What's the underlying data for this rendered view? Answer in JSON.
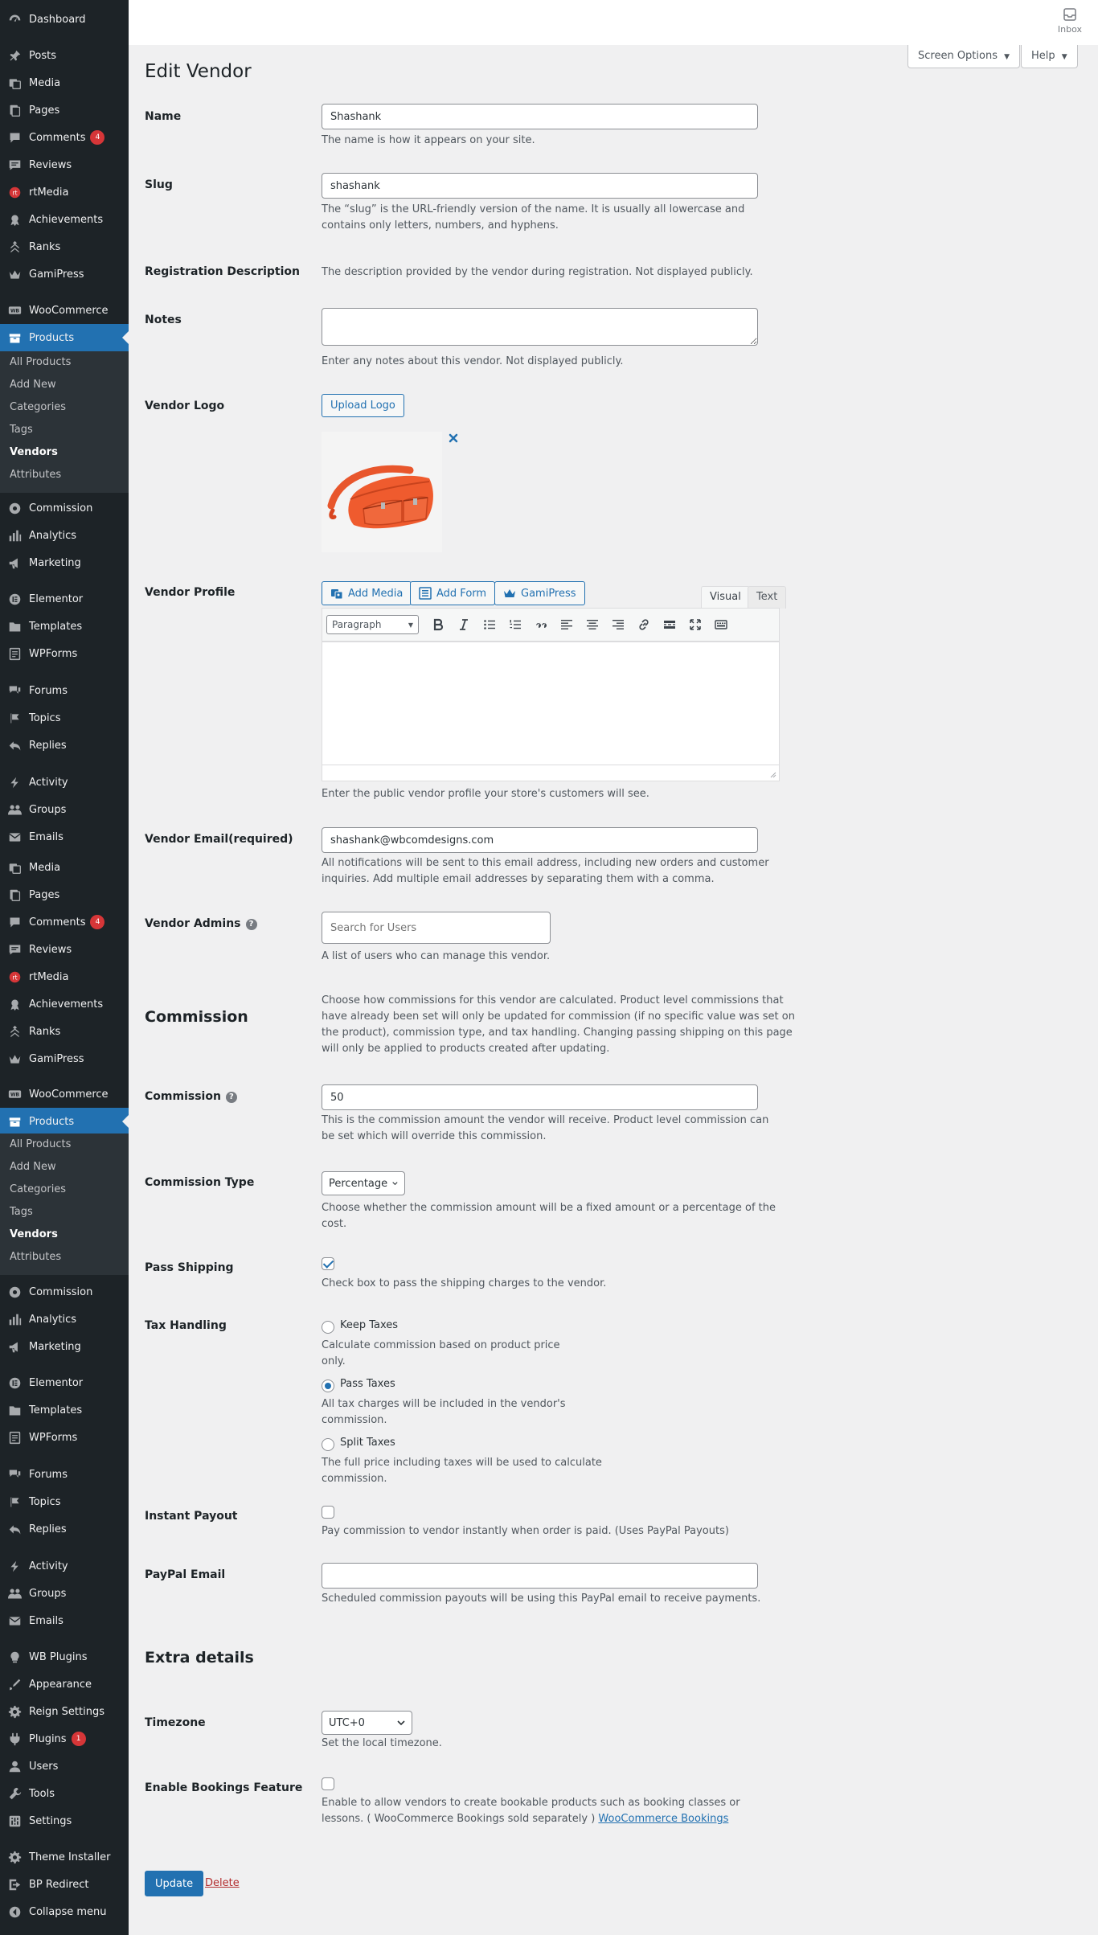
{
  "sidebar": {
    "items": [
      {
        "label": "Dashboard",
        "icon": "dashboard-icon"
      },
      {
        "label": "Posts",
        "icon": "pin-icon"
      },
      {
        "label": "Media",
        "icon": "media-icon"
      },
      {
        "label": "Pages",
        "icon": "pages-icon"
      },
      {
        "label": "Comments",
        "icon": "comments-icon",
        "badge": "4"
      },
      {
        "label": "Reviews",
        "icon": "reviews-icon"
      },
      {
        "label": "rtMedia",
        "icon": "rtmedia-icon"
      },
      {
        "label": "Achievements",
        "icon": "achievements-icon"
      },
      {
        "label": "Ranks",
        "icon": "ranks-icon"
      },
      {
        "label": "GamiPress",
        "icon": "gamipress-icon"
      },
      {
        "label": "WooCommerce",
        "icon": "woocommerce-icon"
      },
      {
        "label": "Products",
        "icon": "products-icon"
      },
      {
        "label": "Commission",
        "icon": "commission-icon"
      },
      {
        "label": "Analytics",
        "icon": "analytics-icon"
      },
      {
        "label": "Marketing",
        "icon": "marketing-icon"
      },
      {
        "label": "Elementor",
        "icon": "elementor-icon"
      },
      {
        "label": "Templates",
        "icon": "templates-icon"
      },
      {
        "label": "WPForms",
        "icon": "wpforms-icon"
      },
      {
        "label": "Forums",
        "icon": "forums-icon"
      },
      {
        "label": "Topics",
        "icon": "topics-icon"
      },
      {
        "label": "Replies",
        "icon": "replies-icon"
      },
      {
        "label": "Activity",
        "icon": "activity-icon"
      },
      {
        "label": "Groups",
        "icon": "groups-icon"
      },
      {
        "label": "Emails",
        "icon": "emails-icon"
      },
      {
        "label": "Media",
        "icon": "media-icon"
      },
      {
        "label": "Pages",
        "icon": "pages-icon"
      },
      {
        "label": "Comments",
        "icon": "comments-icon",
        "badge": "4"
      },
      {
        "label": "Reviews",
        "icon": "reviews-icon"
      },
      {
        "label": "rtMedia",
        "icon": "rtmedia-icon"
      },
      {
        "label": "Achievements",
        "icon": "achievements-icon"
      },
      {
        "label": "Ranks",
        "icon": "ranks-icon"
      },
      {
        "label": "GamiPress",
        "icon": "gamipress-icon"
      },
      {
        "label": "WooCommerce",
        "icon": "woocommerce-icon"
      },
      {
        "label": "Products",
        "icon": "products-icon"
      },
      {
        "label": "Commission",
        "icon": "commission-icon"
      },
      {
        "label": "Analytics",
        "icon": "analytics-icon"
      },
      {
        "label": "Marketing",
        "icon": "marketing-icon"
      },
      {
        "label": "Elementor",
        "icon": "elementor-icon"
      },
      {
        "label": "Templates",
        "icon": "templates-icon"
      },
      {
        "label": "WPForms",
        "icon": "wpforms-icon"
      },
      {
        "label": "Forums",
        "icon": "forums-icon"
      },
      {
        "label": "Topics",
        "icon": "topics-icon"
      },
      {
        "label": "Replies",
        "icon": "replies-icon"
      },
      {
        "label": "Activity",
        "icon": "activity-icon"
      },
      {
        "label": "Groups",
        "icon": "groups-icon"
      },
      {
        "label": "Emails",
        "icon": "emails-icon"
      },
      {
        "label": "WB Plugins",
        "icon": "bulb-icon"
      },
      {
        "label": "Appearance",
        "icon": "appearance-icon"
      },
      {
        "label": "Reign Settings",
        "icon": "gear-icon"
      },
      {
        "label": "Plugins",
        "icon": "plugins-icon",
        "badge": "1"
      },
      {
        "label": "Users",
        "icon": "users-icon"
      },
      {
        "label": "Tools",
        "icon": "tools-icon"
      },
      {
        "label": "Settings",
        "icon": "settings-icon"
      },
      {
        "label": "Theme Installer",
        "icon": "gear-icon"
      },
      {
        "label": "BP Redirect",
        "icon": "redirect-icon"
      },
      {
        "label": "Collapse menu",
        "icon": "collapse-icon"
      }
    ],
    "products_sub": [
      "All Products",
      "Add New",
      "Categories",
      "Tags",
      "Vendors",
      "Attributes"
    ]
  },
  "topbar": {
    "inbox_label": "Inbox",
    "screen_options": "Screen Options",
    "help": "Help"
  },
  "page": {
    "title": "Edit Vendor"
  },
  "form": {
    "name": {
      "label": "Name",
      "value": "Shashank",
      "desc": "The name is how it appears on your site."
    },
    "slug": {
      "label": "Slug",
      "value": "shashank",
      "desc1": "The “slug” is the URL-friendly version of the name. It is usually all lowercase and",
      "desc2": "contains only letters, numbers, and hyphens."
    },
    "registration": {
      "label": "Registration Description",
      "desc": "The description provided by the vendor during registration. Not displayed publicly."
    },
    "notes": {
      "label": "Notes",
      "desc": "Enter any notes about this vendor. Not displayed publicly."
    },
    "logo": {
      "label": "Vendor Logo",
      "button": "Upload Logo"
    },
    "profile": {
      "label": "Vendor Profile",
      "add_media": "Add Media",
      "add_form": "Add Form",
      "gamipress": "GamiPress",
      "tab_visual": "Visual",
      "tab_text": "Text",
      "format": "Paragraph",
      "desc": "Enter the public vendor profile your store's customers will see."
    },
    "email": {
      "label": "Vendor Email(required)",
      "value": "shashank@wbcomdesigns.com",
      "desc1": "All notifications will be sent to this email address, including new orders and customer",
      "desc2": "inquiries. Add multiple email addresses by separating them with a comma."
    },
    "admins": {
      "label": "Vendor Admins",
      "placeholder": "Search for Users",
      "desc": "A list of users who can manage this vendor."
    },
    "commission_section": {
      "heading": "Commission",
      "desc": [
        "Choose how commissions for this vendor are calculated. Product level commissions that",
        "have already been set will only be updated for commission (if no specific value was set on",
        "the product), commission type, and tax handling. Changing passing shipping on this page",
        "will only be applied to products created after updating."
      ]
    },
    "commission": {
      "label": "Commission",
      "value": "50",
      "desc1": "This is the commission amount the vendor will receive. Product level commission can",
      "desc2": "be set which will override this commission."
    },
    "commission_type": {
      "label": "Commission Type",
      "value": "Percentage",
      "desc1": "Choose whether the commission amount will be a fixed amount or a percentage of the",
      "desc2": "cost."
    },
    "pass_shipping": {
      "label": "Pass Shipping",
      "checked": true,
      "desc": "Check box to pass the shipping charges to the vendor."
    },
    "tax": {
      "label": "Tax Handling",
      "options": [
        {
          "label": "Keep Taxes",
          "desc1": "Calculate commission based on product price",
          "desc2": "only.",
          "checked": false
        },
        {
          "label": "Pass Taxes",
          "desc1": "All tax charges will be included in the vendor's",
          "desc2": "commission.",
          "checked": true
        },
        {
          "label": "Split Taxes",
          "desc1": "The full price including taxes will be used to calculate",
          "desc2": "commission.",
          "checked": false
        }
      ]
    },
    "instant_payout": {
      "label": "Instant Payout",
      "checked": false,
      "desc": "Pay commission to vendor instantly when order is paid. (Uses PayPal Payouts)"
    },
    "paypal": {
      "label": "PayPal Email",
      "desc": "Scheduled commission payouts will be using this PayPal email to receive payments."
    },
    "extra": {
      "heading": "Extra details"
    },
    "timezone": {
      "label": "Timezone",
      "value": "UTC+0",
      "desc": "Set the local timezone."
    },
    "bookings": {
      "label": "Enable Bookings Feature",
      "checked": false,
      "desc1": "Enable to allow vendors to create bookable products such as booking classes or",
      "desc2": "lessons. ( WooCommerce Bookings sold separately )",
      "link": "WooCommerce Bookings"
    }
  },
  "actions": {
    "update": "Update",
    "delete": "Delete"
  },
  "colors": {
    "accent": "#2271b1",
    "sidebar_bg": "#1d2327",
    "danger": "#d63638"
  }
}
